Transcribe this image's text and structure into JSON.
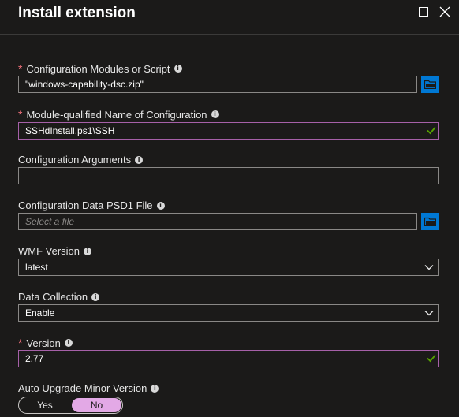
{
  "header": {
    "title": "Install extension",
    "maximize_icon": "maximize-icon",
    "close_icon": "close-icon"
  },
  "fields": {
    "config_modules": {
      "required": "*",
      "label": "Configuration Modules or Script",
      "value": "\"windows-capability-dsc.zip\""
    },
    "module_name": {
      "required": "*",
      "label": "Module-qualified Name of Configuration",
      "value": "SSHdInstall.ps1\\SSH"
    },
    "config_args": {
      "label": "Configuration Arguments",
      "value": ""
    },
    "config_data": {
      "label": "Configuration Data PSD1 File",
      "placeholder": "Select a file"
    },
    "wmf_version": {
      "label": "WMF Version",
      "selected": "latest"
    },
    "data_collection": {
      "label": "Data Collection",
      "selected": "Enable"
    },
    "version": {
      "required": "*",
      "label": "Version",
      "value": "2.77"
    },
    "auto_upgrade": {
      "label": "Auto Upgrade Minor Version",
      "options": [
        "Yes",
        "No"
      ],
      "selected": "No"
    }
  },
  "colors": {
    "background": "#1b1a19",
    "accent": "#0078d4",
    "required": "#f1707b",
    "valid_border": "#a660a8",
    "valid_check": "#57a300",
    "toggle_selected": "#e3a9e6"
  }
}
